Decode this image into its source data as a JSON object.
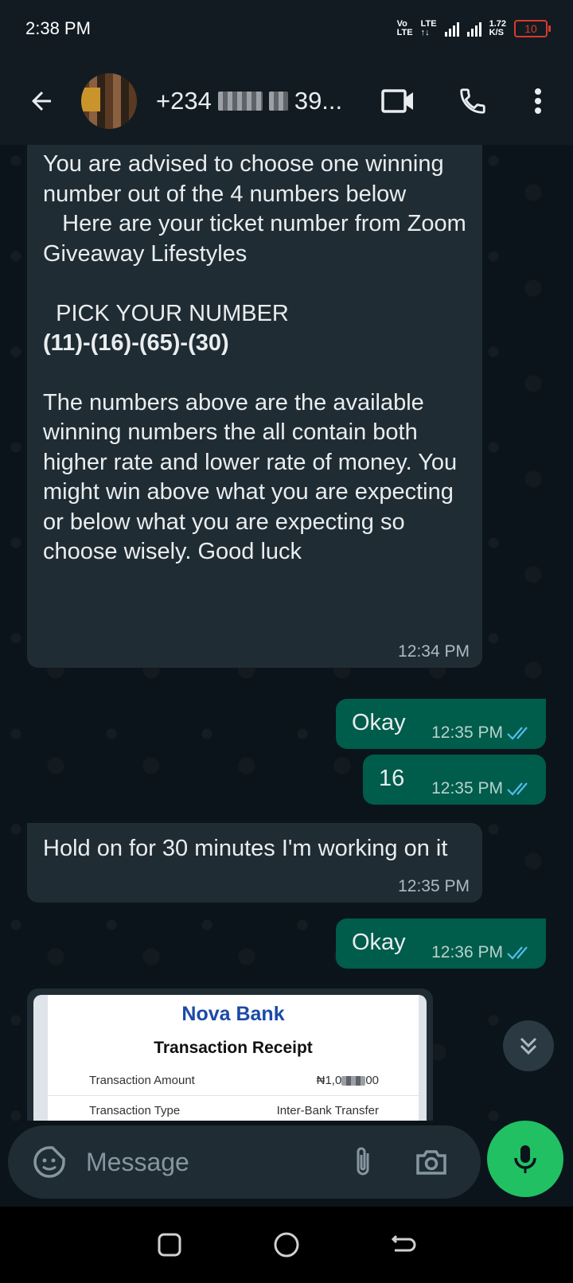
{
  "status_bar": {
    "time": "2:38 PM",
    "volte_top": "Vo",
    "volte_bottom": "LTE",
    "lte_top": "LTE",
    "lte_bottom": "↑↓",
    "speed_top": "1.72",
    "speed_bottom": "K/S",
    "battery": "10"
  },
  "header": {
    "contact_prefix": "+234",
    "contact_suffix": "39...",
    "icons": [
      "back-arrow-icon",
      "video-call-icon",
      "voice-call-icon",
      "more-options-icon"
    ]
  },
  "messages": [
    {
      "direction": "incoming",
      "text_before": "You are advised to choose one winning number out of the 4 numbers below\n   Here are your ticket number from Zoom Giveaway Lifestyles\n\n  PICK YOUR NUMBER\n",
      "bold": "(11)-(16)-(65)-(30)",
      "text_after": "The numbers above are the available winning numbers the all contain both higher rate and lower rate of money. You might win above what you are expecting or below what you are expecting so choose wisely. Good luck",
      "time": "12:34 PM"
    },
    {
      "direction": "outgoing",
      "text": "Okay",
      "time": "12:35 PM",
      "status": "read"
    },
    {
      "direction": "outgoing",
      "text": "16",
      "time": "12:35 PM",
      "status": "read"
    },
    {
      "direction": "incoming",
      "text": "Hold on for 30 minutes I'm working on it",
      "time": "12:35 PM"
    },
    {
      "direction": "outgoing",
      "text": "Okay",
      "time": "12:36 PM",
      "status": "read"
    }
  ],
  "receipt": {
    "bank_name": "Nova Bank",
    "title": "Transaction Receipt",
    "rows": [
      {
        "label": "Transaction Amount",
        "value_prefix": "₦1,0",
        "value_suffix": "00"
      },
      {
        "label": "Transaction Type",
        "value": "Inter-Bank Transfer"
      }
    ]
  },
  "composer": {
    "placeholder": "Message"
  },
  "colors": {
    "header_bg": "#121b22",
    "chat_bg": "#0b141a",
    "incoming_bubble": "#202c33",
    "outgoing_bubble": "#005c4b",
    "mic_button": "#21c063",
    "read_ticks": "#53bdeb"
  }
}
